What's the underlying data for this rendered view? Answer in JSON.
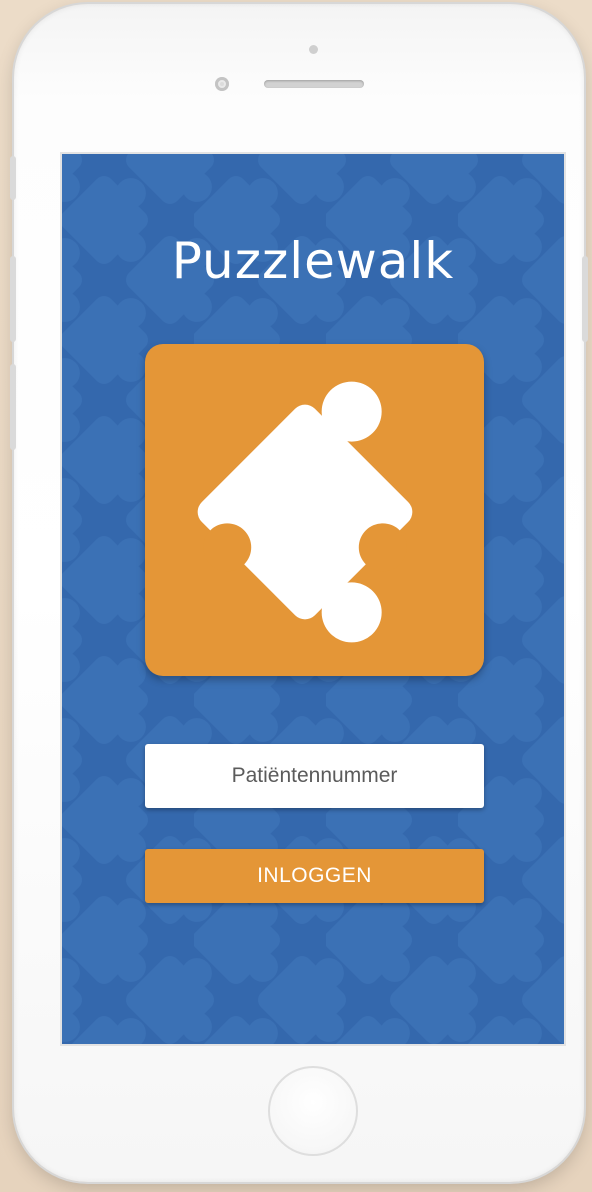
{
  "app": {
    "title": "Puzzlewalk"
  },
  "login": {
    "patient_number_placeholder": "Patiëntennummer",
    "patient_number_value": "",
    "login_label": "INLOGGEN"
  },
  "icons": {
    "logo": "puzzle-piece-icon",
    "background": "puzzle-pattern"
  },
  "colors": {
    "background_blue": "#3468ad",
    "accent_orange": "#e49637",
    "text_white": "#ffffff",
    "field_white": "#ffffff"
  }
}
